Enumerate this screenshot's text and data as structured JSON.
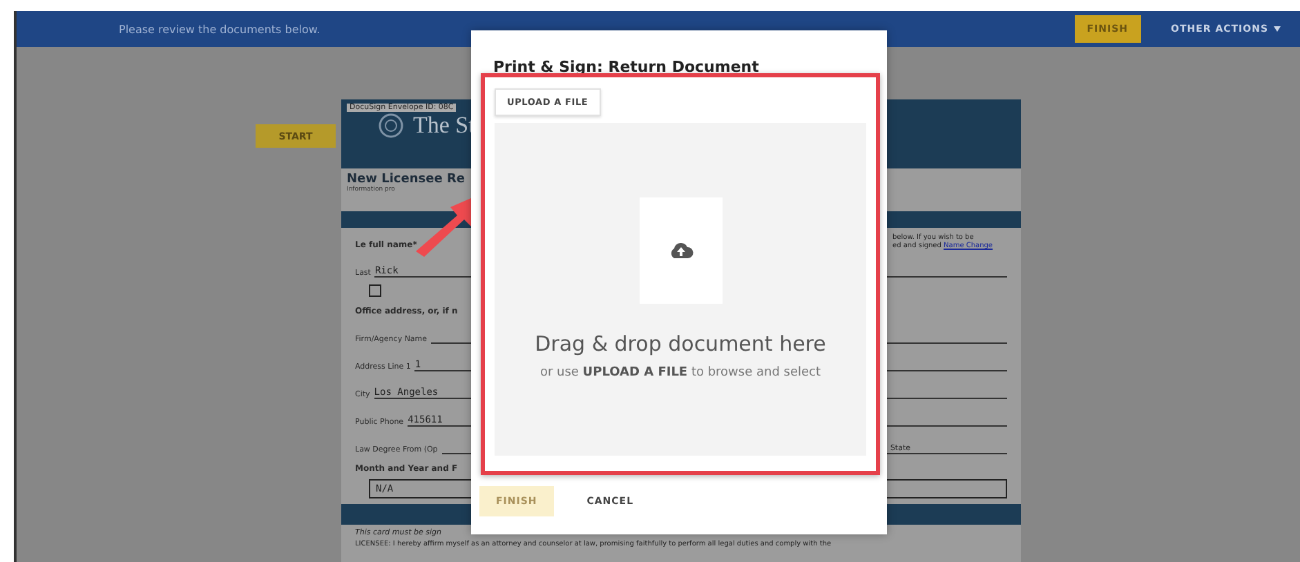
{
  "top_bar": {
    "message": "Please review the documents below.",
    "finish_button": "FINISH",
    "other_actions": "OTHER ACTIONS"
  },
  "start_button": "START",
  "document": {
    "envelope_id": "DocuSign Envelope ID: 08C",
    "org_name": "The St",
    "title": "New Licensee Re",
    "subtitle": "Information pro",
    "intro_right": [
      "below. If you wish to be",
      "ed and signed "
    ],
    "intro_link": "Name Change",
    "lines": [
      {
        "kind": "heading",
        "label": "Le      full name*"
      },
      {
        "kind": "field",
        "label": "Last",
        "value": "Rick"
      },
      {
        "kind": "checkbox",
        "checked": false
      },
      {
        "kind": "heading",
        "label": "Office address, or, if n"
      },
      {
        "kind": "field",
        "label": "Firm/Agency Name"
      },
      {
        "kind": "field",
        "label": "Address Line 1",
        "value": "1"
      },
      {
        "kind": "field",
        "label": "City",
        "value": "Los Angeles"
      },
      {
        "kind": "field",
        "label": "Public Phone",
        "value": "415611"
      },
      {
        "kind": "field",
        "label": "Law Degree From (Op",
        "right": "State"
      },
      {
        "kind": "heading",
        "label": "Month and Year and F"
      },
      {
        "kind": "boxed",
        "value": "N/A"
      }
    ],
    "note": "This card must be sign",
    "licensee": "LICENSEE: I hereby affirm myself as an attorney and counselor at law, promising faithfully to perform all legal duties and comply with the"
  },
  "modal": {
    "title": "Print & Sign: Return Document",
    "upload_button": "UPLOAD A FILE",
    "drop_title": "Drag & drop document here",
    "drop_hint": "or use **UPLOAD A FILE** to browse and select",
    "buttons": [
      {
        "label": "FINISH",
        "disabled": true
      },
      {
        "label": "CANCEL",
        "disabled": false
      }
    ]
  }
}
